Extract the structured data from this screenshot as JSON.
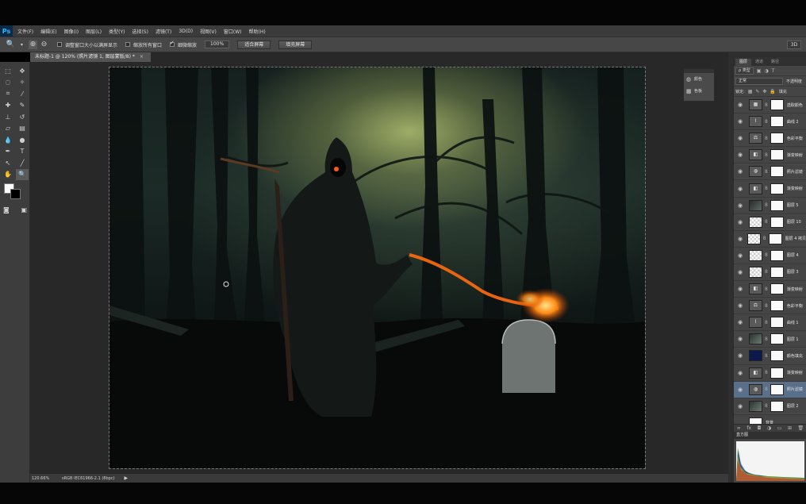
{
  "app": {
    "logo": "Ps"
  },
  "menu": [
    "文件(F)",
    "编辑(E)",
    "图像(I)",
    "图层(L)",
    "类型(Y)",
    "选择(S)",
    "滤镜(T)",
    "3D(D)",
    "视图(V)",
    "窗口(W)",
    "帮助(H)"
  ],
  "options": {
    "resize_windows_label": "调整窗口大小以满屏显示",
    "zoom_all_label": "缩放所有窗口",
    "scrubby_zoom_label": "细微缩放",
    "zoom_value": "100%",
    "fit_screen_label": "适合屏幕",
    "fill_screen_label": "填充屏幕",
    "mode_3d": "3D"
  },
  "document": {
    "tab_title": "未标题-1 @ 120% (照片滤镜 1, 图层蒙版/8) *",
    "close": "×"
  },
  "floating_panel": {
    "row1_label": "颜色",
    "row2_label": "色板"
  },
  "layers_panel": {
    "tabs": [
      "图层",
      "通道",
      "路径"
    ],
    "filter_kind": "ρ 类型",
    "blend_mode": "正常",
    "opacity_label": "不透明度",
    "lock_label": "锁定:",
    "fill_label": "填充",
    "layers": [
      {
        "name": "选取颜色",
        "thumb": "adj",
        "icon": "▦",
        "selected": false,
        "visible": true
      },
      {
        "name": "曲线 2",
        "thumb": "adj",
        "icon": "⌇",
        "selected": false,
        "visible": true
      },
      {
        "name": "色彩平衡",
        "thumb": "adj",
        "icon": "⚖",
        "selected": false,
        "visible": true
      },
      {
        "name": "渐变映射",
        "thumb": "adj",
        "icon": "◧",
        "selected": false,
        "visible": true
      },
      {
        "name": "照片滤镜",
        "thumb": "adj",
        "icon": "◍",
        "selected": false,
        "visible": true
      },
      {
        "name": "渐变映射",
        "thumb": "adj",
        "icon": "◧",
        "selected": false,
        "visible": true
      },
      {
        "name": "图层 5",
        "thumb": "dark",
        "icon": "",
        "selected": false,
        "visible": true
      },
      {
        "name": "图层 10",
        "thumb": "checker",
        "icon": "",
        "selected": false,
        "visible": true
      },
      {
        "name": "图层 4 拷贝",
        "thumb": "checker",
        "icon": "",
        "selected": false,
        "visible": true
      },
      {
        "name": "图层 4",
        "thumb": "checker",
        "icon": "",
        "selected": false,
        "visible": true
      },
      {
        "name": "图层 3",
        "thumb": "checker",
        "icon": "",
        "selected": false,
        "visible": true
      },
      {
        "name": "渐变映射",
        "thumb": "adj",
        "icon": "◧",
        "selected": false,
        "visible": true
      },
      {
        "name": "色彩平衡",
        "thumb": "adj",
        "icon": "⚖",
        "selected": false,
        "visible": true
      },
      {
        "name": "曲线 1",
        "thumb": "adj",
        "icon": "⌇",
        "selected": false,
        "visible": true
      },
      {
        "name": "图层 1",
        "thumb": "photo",
        "icon": "",
        "selected": false,
        "visible": true
      },
      {
        "name": "颜色填充",
        "thumb": "navy",
        "icon": "",
        "selected": false,
        "visible": true
      },
      {
        "name": "渐变映射",
        "thumb": "adj",
        "icon": "◧",
        "selected": false,
        "visible": true
      },
      {
        "name": "照片滤镜",
        "thumb": "adj",
        "icon": "◍",
        "selected": true,
        "visible": true
      },
      {
        "name": "图层 2",
        "thumb": "photo",
        "icon": "",
        "selected": false,
        "visible": true
      },
      {
        "name": "背景",
        "thumb": "white",
        "icon": "",
        "selected": false,
        "visible": false
      }
    ],
    "footer_icons": [
      "∞",
      "fx",
      "◘",
      "◑",
      "▭",
      "⊞",
      "🗑"
    ]
  },
  "histogram": {
    "tab_label": "直方图"
  },
  "status": {
    "zoom": "120.66%",
    "info": "sRGB IEC61966-2.1 (8bpc)",
    "arrow": "▶"
  },
  "colors": {
    "selected_layer": "#5a6f8a",
    "panel_bg": "#454545",
    "ps_blue": "#32b3ff"
  }
}
